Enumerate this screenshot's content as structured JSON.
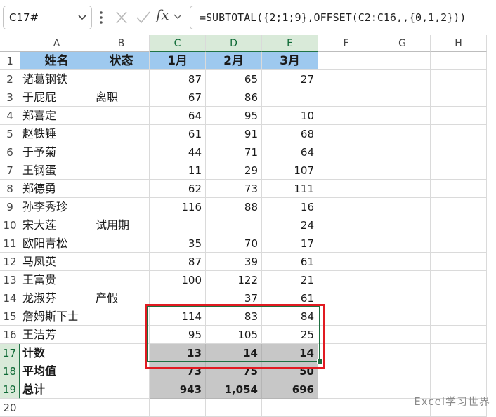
{
  "formula_bar": {
    "name_box": "C17#",
    "fx_label": "fx",
    "formula": "=SUBTOTAL({2;1;9},OFFSET(C2:C16,,{0,1,2}))"
  },
  "sheet": {
    "columns": [
      "A",
      "B",
      "C",
      "D",
      "E",
      "F",
      "G",
      "H"
    ],
    "rows": [
      "1",
      "2",
      "3",
      "4",
      "5",
      "6",
      "7",
      "8",
      "9",
      "10",
      "11",
      "12",
      "13",
      "14",
      "15",
      "16",
      "17",
      "18",
      "19",
      "20"
    ],
    "header_row": [
      "姓名",
      "状态",
      "1月",
      "2月",
      "3月"
    ],
    "data": [
      [
        "诸葛钢铁",
        "",
        "87",
        "65",
        "27"
      ],
      [
        "于屁屁",
        "离职",
        "67",
        "86",
        ""
      ],
      [
        "郑喜定",
        "",
        "64",
        "95",
        "10"
      ],
      [
        "赵铁锤",
        "",
        "61",
        "91",
        "68"
      ],
      [
        "于予菊",
        "",
        "44",
        "71",
        "64"
      ],
      [
        "王钢蛋",
        "",
        "11",
        "29",
        "107"
      ],
      [
        "郑德勇",
        "",
        "62",
        "73",
        "111"
      ],
      [
        "孙李秀珍",
        "",
        "116",
        "88",
        "16"
      ],
      [
        "宋大莲",
        "试用期",
        "",
        "",
        "24"
      ],
      [
        "欧阳青松",
        "",
        "35",
        "70",
        "17"
      ],
      [
        "马凤英",
        "",
        "87",
        "39",
        "61"
      ],
      [
        "王富贵",
        "",
        "100",
        "122",
        "21"
      ],
      [
        "龙淑芬",
        "产假",
        "",
        "37",
        "61"
      ],
      [
        "詹姆斯下士",
        "",
        "114",
        "83",
        "84"
      ],
      [
        "王洁芳",
        "",
        "95",
        "105",
        "25"
      ]
    ],
    "summary": [
      [
        "计数",
        "",
        "13",
        "14",
        "14"
      ],
      [
        "平均值",
        "",
        "73",
        "75",
        "50"
      ],
      [
        "总计",
        "",
        "943",
        "1,054",
        "696"
      ]
    ]
  },
  "colors": {
    "header_fill": "#9ec9ef",
    "selection_fill": "#c7c7c7",
    "highlight_box": "#e11b22",
    "excel_green": "#217346"
  },
  "watermark": "Excel学习世界"
}
